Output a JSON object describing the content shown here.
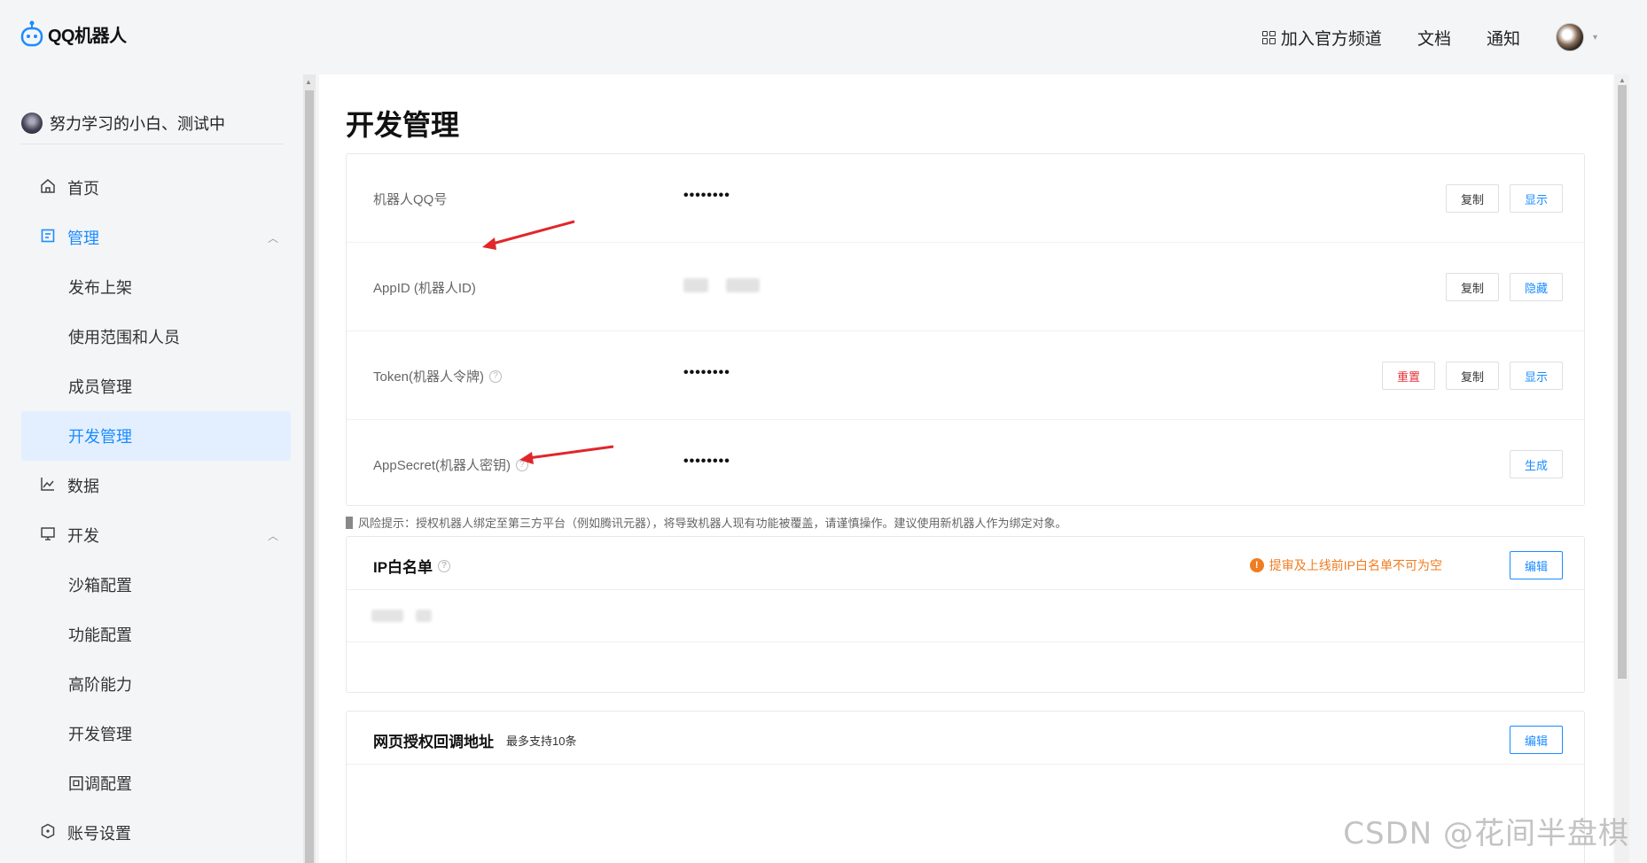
{
  "brand": {
    "name": "QQ机器人"
  },
  "topnav": {
    "join_channel": "加入官方频道",
    "docs": "文档",
    "notify": "通知"
  },
  "sidebar": {
    "user": "努力学习的小白、测试中",
    "items": [
      {
        "label": "首页",
        "icon": "home-icon"
      },
      {
        "label": "管理",
        "icon": "document-icon"
      },
      {
        "label": "发布上架"
      },
      {
        "label": "使用范围和人员"
      },
      {
        "label": "成员管理"
      },
      {
        "label": "开发管理"
      },
      {
        "label": "数据",
        "icon": "chart-icon"
      },
      {
        "label": "开发",
        "icon": "monitor-icon"
      },
      {
        "label": "沙箱配置"
      },
      {
        "label": "功能配置"
      },
      {
        "label": "高阶能力"
      },
      {
        "label": "开发管理"
      },
      {
        "label": "回调配置"
      },
      {
        "label": "账号设置",
        "icon": "hexagon-icon"
      }
    ]
  },
  "main": {
    "title": "开发管理",
    "credentials": [
      {
        "label": "机器人QQ号",
        "value": "••••••••",
        "buttons": [
          "复制",
          "显示"
        ]
      },
      {
        "label": "AppID (机器人ID)",
        "value": "",
        "buttons": [
          "复制",
          "隐藏"
        ]
      },
      {
        "label": "Token(机器人令牌)",
        "value": "••••••••",
        "buttons": [
          "重置",
          "复制",
          "显示"
        ]
      },
      {
        "label": "AppSecret(机器人密钥)",
        "value": "••••••••",
        "buttons": [
          "生成"
        ]
      }
    ],
    "risk_note": "风险提示：授权机器人绑定至第三方平台（例如腾讯元器），将导致机器人现有功能被覆盖，请谨慎操作。建议使用新机器人作为绑定对象。",
    "ip_whitelist": {
      "title": "IP白名单",
      "warning": "提审及上线前IP白名单不可为空",
      "edit": "编辑"
    },
    "callback": {
      "title": "网页授权回调地址",
      "subtitle": "最多支持10条",
      "edit": "编辑"
    }
  },
  "watermark": "CSDN @花间半盘棋",
  "colors": {
    "accent": "#1a8cff",
    "danger": "#e5323b",
    "warning": "#f07c21",
    "annotation": "#e0262a"
  }
}
